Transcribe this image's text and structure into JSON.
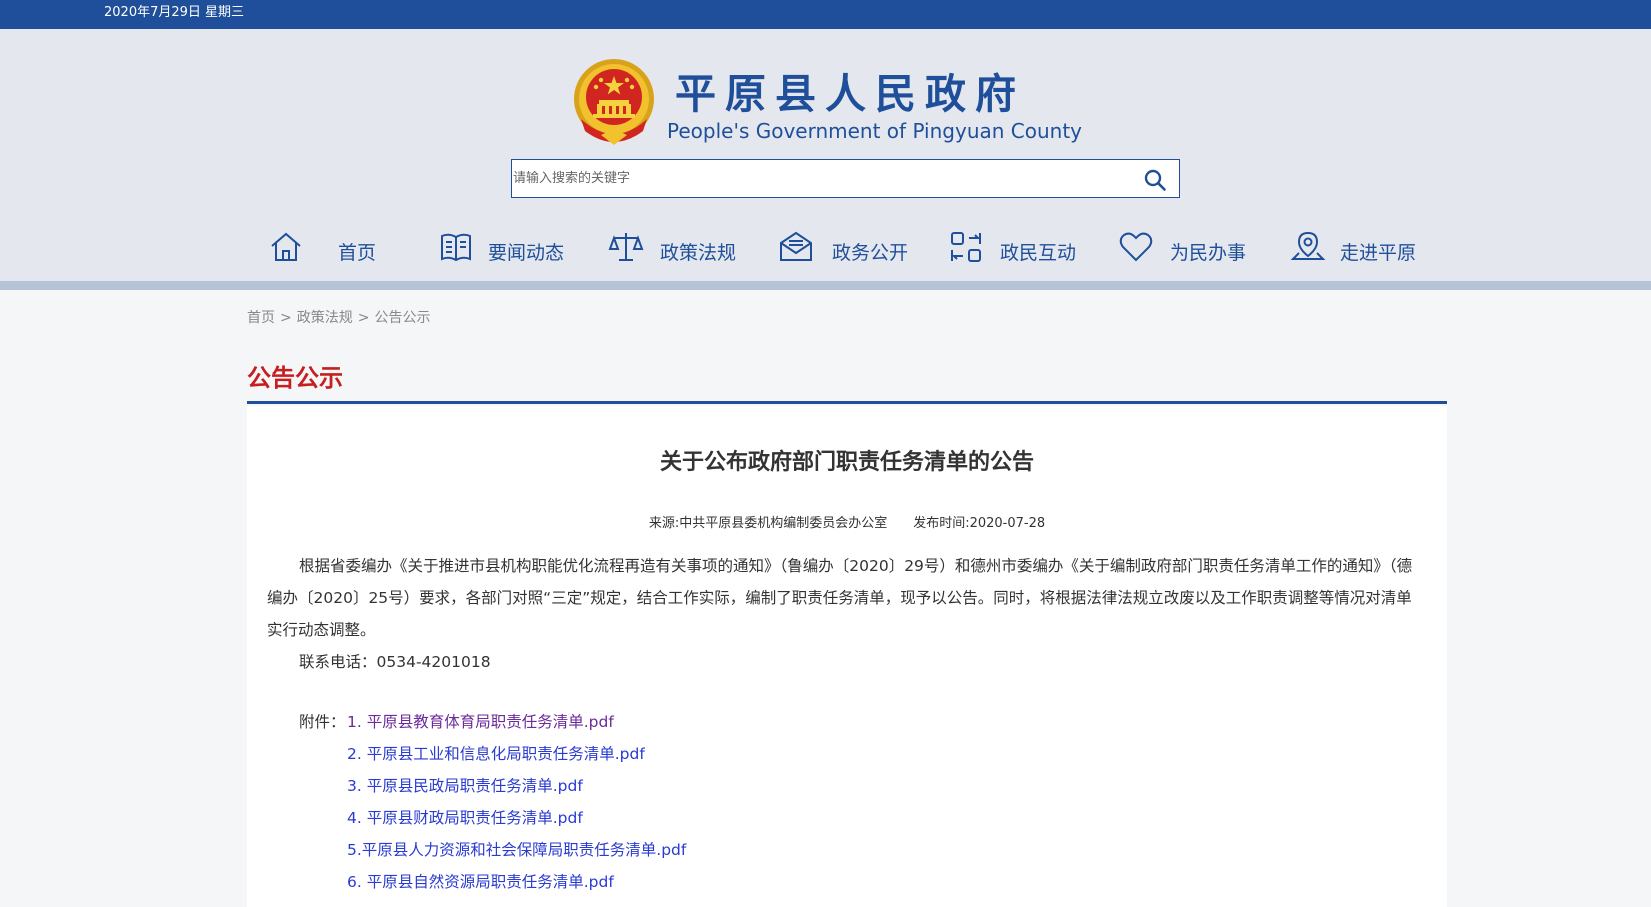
{
  "topbar": {
    "date": "2020年7月29日 星期三"
  },
  "header": {
    "title": "平原县人民政府",
    "subtitle": "People's Government of Pingyuan County",
    "search_placeholder": "请输入搜索的关键字"
  },
  "nav": [
    {
      "label": "首页",
      "icon": "home-icon"
    },
    {
      "label": "要闻动态",
      "icon": "book-icon"
    },
    {
      "label": "政策法规",
      "icon": "scale-icon"
    },
    {
      "label": "政务公开",
      "icon": "mail-icon"
    },
    {
      "label": "政民互动",
      "icon": "interaction-icon"
    },
    {
      "label": "为民办事",
      "icon": "heart-icon"
    },
    {
      "label": "走进平原",
      "icon": "map-pin-icon"
    }
  ],
  "breadcrumb": [
    "首页",
    "政策法规",
    "公告公示"
  ],
  "section_title": "公告公示",
  "article": {
    "title": "关于公布政府部门职责任务清单的公告",
    "source": "来源:中共平原县委机构编制委员会办公室",
    "date": "发布时间:2020-07-28",
    "paragraph": "根据省委编办《关于推进市县机构职能优化流程再造有关事项的通知》（鲁编办〔2020〕29号）和德州市委编办《关于编制政府部门职责任务清单工作的通知》（德编办〔2020〕25号）要求，各部门对照“三定”规定，结合工作实际，编制了职责任务清单，现予以公告。同时，将根据法律法规立改废以及工作职责调整等情况对清单实行动态调整。",
    "phone": "联系电话：0534-4201018",
    "attachments_label": "附件：",
    "attachments": [
      "1. 平原县教育体育局职责任务清单.pdf",
      "2. 平原县工业和信息化局职责任务清单.pdf",
      "3. 平原县民政局职责任务清单.pdf",
      "4. 平原县财政局职责任务清单.pdf",
      "5.平原县人力资源和社会保障局职责任务清单.pdf",
      "6. 平原县自然资源局职责任务清单.pdf"
    ]
  },
  "colors": {
    "brand_blue": "#1f4f9a",
    "title_red": "#c51f1f",
    "link_blue": "#2a3bd1",
    "visited_purple": "#6c2a9b"
  }
}
